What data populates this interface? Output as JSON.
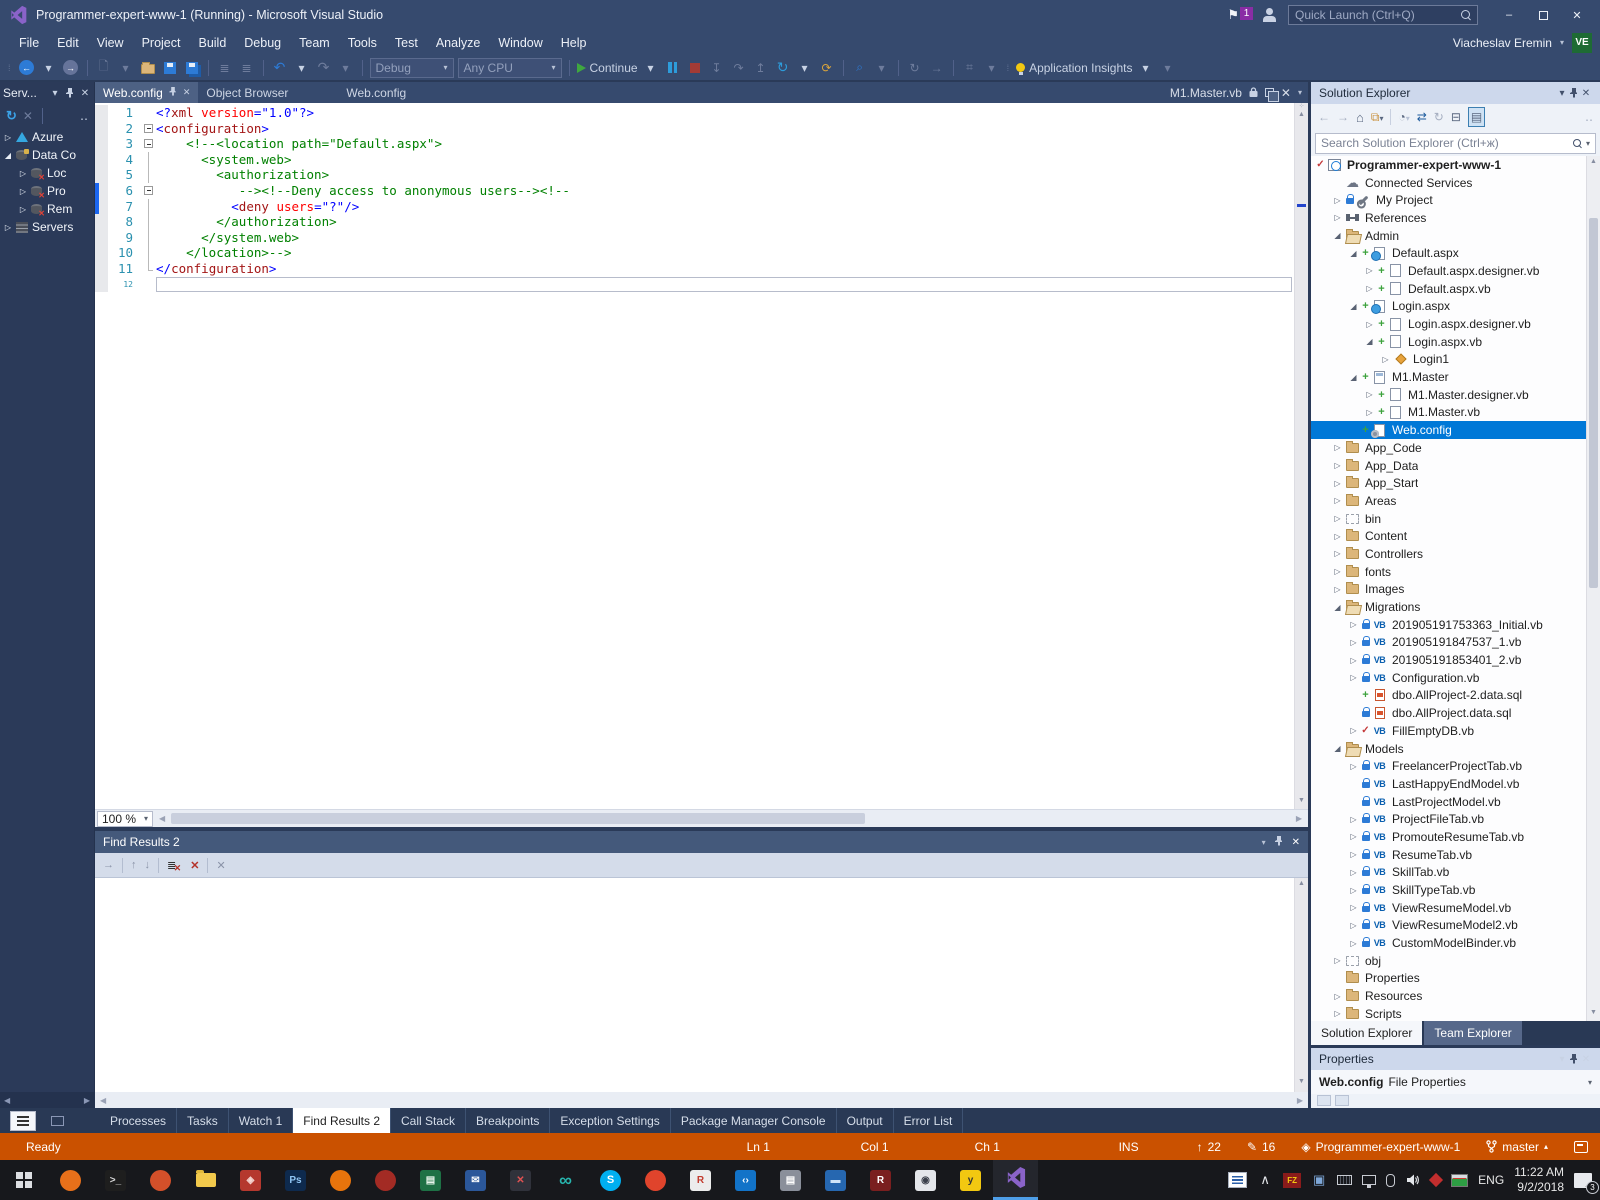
{
  "titlebar": {
    "title": "Programmer-expert-www-1 (Running) - Microsoft Visual Studio",
    "quick_launch_placeholder": "Quick Launch (Ctrl+Q)",
    "notification_badge": "1",
    "minimize": "–",
    "close": "✕"
  },
  "menubar": {
    "items": [
      "File",
      "Edit",
      "View",
      "Project",
      "Build",
      "Debug",
      "Team",
      "Tools",
      "Test",
      "Analyze",
      "Window",
      "Help"
    ],
    "user_name": "Viacheslav Eremin",
    "user_initials": "VE"
  },
  "toolbar": {
    "debug_config": "Debug",
    "platform": "Any CPU",
    "continue_label": "Continue",
    "app_insights_label": "Application Insights"
  },
  "server_explorer": {
    "title": "Serv...",
    "items": [
      {
        "label": "Azure",
        "icon": "azure",
        "exp": "c",
        "lvl": 1
      },
      {
        "label": "Data Co",
        "icon": "db",
        "exp": "e",
        "lvl": 1
      },
      {
        "label": "Loc",
        "icon": "dberr",
        "exp": "c",
        "lvl": 2
      },
      {
        "label": "Pro",
        "icon": "dberr",
        "exp": "c",
        "lvl": 2
      },
      {
        "label": "Rem",
        "icon": "dberr",
        "exp": "c",
        "lvl": 2
      },
      {
        "label": "Servers",
        "icon": "servers",
        "exp": "c",
        "lvl": 1
      }
    ]
  },
  "editor": {
    "tabs": [
      {
        "label": "Web.config",
        "active": true
      },
      {
        "label": "Object Browser",
        "active": false
      },
      {
        "label": "Web.config",
        "active": false
      }
    ],
    "preview_tab": "M1.Master.vb",
    "zoom": "100 %",
    "lines": [
      {
        "n": 1,
        "m": "",
        "s": [
          [
            "<?",
            "d"
          ],
          [
            "xml",
            "n"
          ],
          [
            " ",
            "p"
          ],
          [
            "version",
            "a"
          ],
          [
            "=",
            "d"
          ],
          [
            "\"1.0\"",
            "v"
          ],
          [
            "?>",
            "d"
          ]
        ]
      },
      {
        "n": 2,
        "m": "box",
        "s": [
          [
            "<",
            "d"
          ],
          [
            "configuration",
            "n"
          ],
          [
            ">",
            "d"
          ]
        ]
      },
      {
        "n": 3,
        "m": "box",
        "s": [
          [
            "    ",
            "p"
          ],
          [
            "<!--<location path=\"Default.aspx\">",
            "c"
          ]
        ]
      },
      {
        "n": 4,
        "m": "line",
        "s": [
          [
            "      ",
            "p"
          ],
          [
            "<system.web>",
            "c"
          ]
        ]
      },
      {
        "n": 5,
        "m": "line",
        "s": [
          [
            "        ",
            "p"
          ],
          [
            "<authorization>",
            "c"
          ]
        ]
      },
      {
        "n": 6,
        "m": "box",
        "chg": true,
        "s": [
          [
            "           ",
            "p"
          ],
          [
            "--><!--Deny access to anonymous users--><!--",
            "c"
          ]
        ]
      },
      {
        "n": 7,
        "m": "line",
        "chg": true,
        "s": [
          [
            "          ",
            "p"
          ],
          [
            "<",
            "d"
          ],
          [
            "deny",
            "n"
          ],
          [
            " ",
            "p"
          ],
          [
            "users",
            "a"
          ],
          [
            "=",
            "d"
          ],
          [
            "\"?\"",
            "v"
          ],
          [
            "/>",
            "d"
          ]
        ]
      },
      {
        "n": 8,
        "m": "line",
        "s": [
          [
            "        ",
            "p"
          ],
          [
            "</authorization>",
            "c"
          ]
        ]
      },
      {
        "n": 9,
        "m": "line",
        "s": [
          [
            "      ",
            "p"
          ],
          [
            "</system.web>",
            "c"
          ]
        ]
      },
      {
        "n": 10,
        "m": "line",
        "s": [
          [
            "    ",
            "p"
          ],
          [
            "</location>-->",
            "c"
          ]
        ]
      },
      {
        "n": 11,
        "m": "end",
        "s": [
          [
            "</",
            "d"
          ],
          [
            "configuration",
            "n"
          ],
          [
            ">",
            "d"
          ]
        ]
      },
      {
        "n": 12,
        "m": "",
        "caret": true,
        "s": []
      }
    ]
  },
  "find_results": {
    "title": "Find Results 2"
  },
  "bottom_tabs": {
    "items": [
      "Processes",
      "Tasks",
      "Watch 1",
      "Find Results 2",
      "Call Stack",
      "Breakpoints",
      "Exception Settings",
      "Package Manager Console",
      "Output",
      "Error List"
    ],
    "active": "Find Results 2"
  },
  "solution_explorer": {
    "title": "Solution Explorer",
    "search_placeholder": "Search Solution Explorer (Ctrl+ж)",
    "tabs": [
      "Solution Explorer",
      "Team Explorer"
    ],
    "tree": [
      {
        "label": "Programmer-expert-www-1",
        "icon": "proj",
        "st": "check",
        "exp": "",
        "lvl": 0,
        "bold": true
      },
      {
        "label": "Connected Services",
        "icon": "cloud",
        "st": "",
        "exp": "",
        "lvl": 1
      },
      {
        "label": "My Project",
        "icon": "wrench",
        "st": "lock",
        "exp": "c",
        "lvl": 1
      },
      {
        "label": "References",
        "icon": "refs",
        "st": "",
        "exp": "c",
        "lvl": 1
      },
      {
        "label": "Admin",
        "icon": "folder-open",
        "st": "",
        "exp": "e",
        "lvl": 1
      },
      {
        "label": "Default.aspx",
        "icon": "aspx",
        "st": "plus",
        "exp": "e",
        "lvl": 2
      },
      {
        "label": "Default.aspx.designer.vb",
        "icon": "page",
        "st": "plus",
        "exp": "c",
        "lvl": 3
      },
      {
        "label": "Default.aspx.vb",
        "icon": "page",
        "st": "plus",
        "exp": "c",
        "lvl": 3
      },
      {
        "label": "Login.aspx",
        "icon": "aspx",
        "st": "plus",
        "exp": "e",
        "lvl": 2
      },
      {
        "label": "Login.aspx.designer.vb",
        "icon": "page",
        "st": "plus",
        "exp": "c",
        "lvl": 3
      },
      {
        "label": "Login.aspx.vb",
        "icon": "page",
        "st": "plus",
        "exp": "e",
        "lvl": 3
      },
      {
        "label": "Login1",
        "icon": "class",
        "st": "",
        "exp": "c",
        "lvl": 4
      },
      {
        "label": "M1.Master",
        "icon": "master",
        "st": "plus",
        "exp": "e",
        "lvl": 2
      },
      {
        "label": "M1.Master.designer.vb",
        "icon": "page",
        "st": "plus",
        "exp": "c",
        "lvl": 3
      },
      {
        "label": "M1.Master.vb",
        "icon": "page",
        "st": "plus",
        "exp": "c",
        "lvl": 3
      },
      {
        "label": "Web.config",
        "icon": "config",
        "st": "plus",
        "exp": "",
        "lvl": 2,
        "sel": true
      },
      {
        "label": "App_Code",
        "icon": "folder",
        "st": "",
        "exp": "c",
        "lvl": 1
      },
      {
        "label": "App_Data",
        "icon": "folder",
        "st": "",
        "exp": "c",
        "lvl": 1
      },
      {
        "label": "App_Start",
        "icon": "folder",
        "st": "",
        "exp": "c",
        "lvl": 1
      },
      {
        "label": "Areas",
        "icon": "folder",
        "st": "",
        "exp": "c",
        "lvl": 1
      },
      {
        "label": "bin",
        "icon": "ghost",
        "st": "",
        "exp": "c",
        "lvl": 1
      },
      {
        "label": "Content",
        "icon": "folder",
        "st": "",
        "exp": "c",
        "lvl": 1
      },
      {
        "label": "Controllers",
        "icon": "folder",
        "st": "",
        "exp": "c",
        "lvl": 1
      },
      {
        "label": "fonts",
        "icon": "folder",
        "st": "",
        "exp": "c",
        "lvl": 1
      },
      {
        "label": "Images",
        "icon": "folder",
        "st": "",
        "exp": "c",
        "lvl": 1
      },
      {
        "label": "Migrations",
        "icon": "folder-open",
        "st": "",
        "exp": "e",
        "lvl": 1
      },
      {
        "label": "201905191753363_Initial.vb",
        "icon": "vb",
        "st": "lock",
        "exp": "c",
        "lvl": 2
      },
      {
        "label": "201905191847537_1.vb",
        "icon": "vb",
        "st": "lock",
        "exp": "c",
        "lvl": 2
      },
      {
        "label": "201905191853401_2.vb",
        "icon": "vb",
        "st": "lock",
        "exp": "c",
        "lvl": 2
      },
      {
        "label": "Configuration.vb",
        "icon": "vb",
        "st": "lock",
        "exp": "c",
        "lvl": 2
      },
      {
        "label": "dbo.AllProject-2.data.sql",
        "icon": "sql",
        "st": "plus",
        "exp": "",
        "lvl": 2
      },
      {
        "label": "dbo.AllProject.data.sql",
        "icon": "sql",
        "st": "lock",
        "exp": "",
        "lvl": 2
      },
      {
        "label": "FillEmptyDB.vb",
        "icon": "vb",
        "st": "check",
        "exp": "c",
        "lvl": 2
      },
      {
        "label": "Models",
        "icon": "folder-open",
        "st": "",
        "exp": "e",
        "lvl": 1
      },
      {
        "label": "FreelancerProjectTab.vb",
        "icon": "vb",
        "st": "lock",
        "exp": "c",
        "lvl": 2
      },
      {
        "label": "LastHappyEndModel.vb",
        "icon": "vb",
        "st": "lock",
        "exp": "",
        "lvl": 2
      },
      {
        "label": "LastProjectModel.vb",
        "icon": "vb",
        "st": "lock",
        "exp": "",
        "lvl": 2
      },
      {
        "label": "ProjectFileTab.vb",
        "icon": "vb",
        "st": "lock",
        "exp": "c",
        "lvl": 2
      },
      {
        "label": "PromouteResumeTab.vb",
        "icon": "vb",
        "st": "lock",
        "exp": "c",
        "lvl": 2
      },
      {
        "label": "ResumeTab.vb",
        "icon": "vb",
        "st": "lock",
        "exp": "c",
        "lvl": 2
      },
      {
        "label": "SkillTab.vb",
        "icon": "vb",
        "st": "lock",
        "exp": "c",
        "lvl": 2
      },
      {
        "label": "SkillTypeTab.vb",
        "icon": "vb",
        "st": "lock",
        "exp": "c",
        "lvl": 2
      },
      {
        "label": "ViewResumeModel.vb",
        "icon": "vb",
        "st": "lock",
        "exp": "c",
        "lvl": 2
      },
      {
        "label": "ViewResumeModel2.vb",
        "icon": "vb",
        "st": "lock",
        "exp": "c",
        "lvl": 2
      },
      {
        "label": "CustomModelBinder.vb",
        "icon": "vb",
        "st": "lock",
        "exp": "c",
        "lvl": 2
      },
      {
        "label": "obj",
        "icon": "ghost",
        "st": "",
        "exp": "c",
        "lvl": 1
      },
      {
        "label": "Properties",
        "icon": "folder",
        "st": "",
        "exp": "",
        "lvl": 1
      },
      {
        "label": "Resources",
        "icon": "folder",
        "st": "",
        "exp": "c",
        "lvl": 1
      },
      {
        "label": "Scripts",
        "icon": "folder",
        "st": "",
        "exp": "c",
        "lvl": 1
      }
    ]
  },
  "properties": {
    "title": "Properties",
    "object_name": "Web.config",
    "object_kind": "File Properties"
  },
  "statusbar": {
    "message": "Ready",
    "line": "Ln 1",
    "column": "Col 1",
    "character": "Ch 1",
    "mode": "INS",
    "incoming_count": "22",
    "edits_count": "16",
    "repo_name": "Programmer-expert-www-1",
    "branch_name": "master"
  },
  "taskbar": {
    "apps": [
      {
        "name": "firefox",
        "t": "circle",
        "bg": "#E8701A",
        "fg": "#fff",
        "g": ""
      },
      {
        "name": "terminal",
        "t": "sq",
        "bg": "#1E1E1E",
        "fg": "#DADADA",
        "g": ">_"
      },
      {
        "name": "browser-orange",
        "t": "circle",
        "bg": "#D4502A",
        "fg": "#fff",
        "g": ""
      },
      {
        "name": "file-explorer",
        "t": "folder",
        "bg": "",
        "fg": "",
        "g": ""
      },
      {
        "name": "app-red",
        "t": "sq",
        "bg": "#B5382E",
        "fg": "#F6D8D4",
        "g": "◈"
      },
      {
        "name": "photoshop",
        "t": "sq",
        "bg": "#0E2A4E",
        "fg": "#8FC4F2",
        "g": "Ps"
      },
      {
        "name": "opera-orange",
        "t": "circle",
        "bg": "#E8740C",
        "fg": "#fff",
        "g": ""
      },
      {
        "name": "app-darkred",
        "t": "circle",
        "bg": "#A32B24",
        "fg": "#fff",
        "g": ""
      },
      {
        "name": "excel-green",
        "t": "sq",
        "bg": "#1E7145",
        "fg": "#E8F5EC",
        "g": "▤"
      },
      {
        "name": "mail-blue",
        "t": "sq",
        "bg": "#2B579A",
        "fg": "#fff",
        "g": "✉"
      },
      {
        "name": "app-x",
        "t": "sq",
        "bg": "#30323B",
        "fg": "#E05252",
        "g": "✕"
      },
      {
        "name": "infinity-teal",
        "t": "bare",
        "bg": "",
        "fg": "#27B5AE",
        "g": "∞"
      },
      {
        "name": "skype",
        "t": "circle",
        "bg": "#00AFF0",
        "fg": "#fff",
        "g": "S"
      },
      {
        "name": "opera",
        "t": "circle",
        "bg": "#E0442C",
        "fg": "#fff",
        "g": ""
      },
      {
        "name": "app-r-light",
        "t": "sq",
        "bg": "#ECECEC",
        "fg": "#C23B2E",
        "g": "R"
      },
      {
        "name": "vscode",
        "t": "sq",
        "bg": "#1273C8",
        "fg": "#fff",
        "g": "‹›"
      },
      {
        "name": "app-gray",
        "t": "sq",
        "bg": "#8A8F9A",
        "fg": "#fff",
        "g": "▤"
      },
      {
        "name": "remote-desktop",
        "t": "sq",
        "bg": "#2667B0",
        "fg": "#CFE4F8",
        "g": "▬"
      },
      {
        "name": "app-r-dark",
        "t": "sq",
        "bg": "#7A1F1F",
        "fg": "#fff",
        "g": "R"
      },
      {
        "name": "app-eye",
        "t": "sq",
        "bg": "#E4E6EA",
        "fg": "#3A3F4A",
        "g": "◉"
      },
      {
        "name": "app-yellow",
        "t": "sq",
        "bg": "#F2C811",
        "fg": "#333",
        "g": "y"
      },
      {
        "name": "visual-studio",
        "t": "vs",
        "bg": "",
        "fg": "",
        "g": "",
        "active": true
      }
    ],
    "tray": {
      "filezilla_label": "FZ",
      "language": "ENG",
      "time": "11:22 AM",
      "date": "9/2/2018",
      "notification_count": "3"
    }
  }
}
